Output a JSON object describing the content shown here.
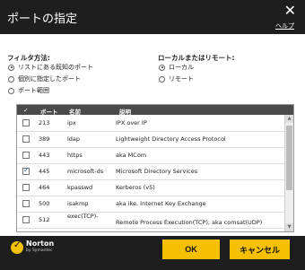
{
  "dialog": {
    "title": "ポートの指定",
    "close_symbol": "✕",
    "help_label": "ヘルプ"
  },
  "filter": {
    "title": "フィルタ方法:",
    "options": [
      {
        "label": "リストにある既知のポート",
        "selected": true
      },
      {
        "label": "個別に指定したポート",
        "selected": false
      },
      {
        "label": "ポート範囲",
        "selected": false
      }
    ]
  },
  "location": {
    "title": "ローカルまたはリモート:",
    "options": [
      {
        "label": "ローカル",
        "selected": true
      },
      {
        "label": "リモート",
        "selected": false
      }
    ]
  },
  "table": {
    "headers": {
      "check": "✓",
      "port": "ポート",
      "name": "名前",
      "description": "説明"
    },
    "rows": [
      {
        "checked": false,
        "port": "213",
        "name": "ipx",
        "description": "IPX over IP"
      },
      {
        "checked": false,
        "port": "389",
        "name": "ldap",
        "description": "Lightweight Directory Access Protocol"
      },
      {
        "checked": false,
        "port": "443",
        "name": "https",
        "description": "aka MCom"
      },
      {
        "checked": true,
        "port": "445",
        "name": "microsoft-ds",
        "description": "Microsoft Directory Services"
      },
      {
        "checked": false,
        "port": "464",
        "name": "kpasswd",
        "description": "Kerberos (v5)"
      },
      {
        "checked": false,
        "port": "500",
        "name": "isakmp",
        "description": "aka ike, Internet Key Exchange"
      },
      {
        "checked": false,
        "port": "512",
        "name": "exec(TCP)-",
        "description": "Remote Process Execution(TCP), aka comsat(UDP)"
      }
    ]
  },
  "footer": {
    "brand_name": "Norton",
    "brand_sub": "by Symantec",
    "ok_label": "OK",
    "cancel_label": "キャンセル"
  },
  "colors": {
    "accent": "#f5c000",
    "titlebar": "#1e1e1e",
    "table_header": "#4a4a4a"
  }
}
